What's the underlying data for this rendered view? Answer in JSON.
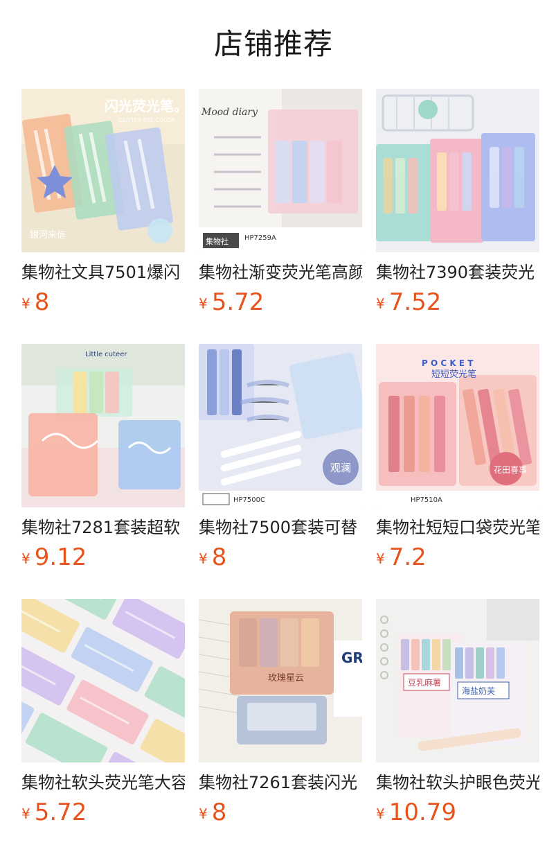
{
  "header": {
    "title": "店铺推荐"
  },
  "currency_symbol": "¥",
  "products": [
    {
      "name": "集物社文具7501爆闪",
      "price": "8",
      "image_text": [
        "闪光荧光笔。",
        "GLITTER EYE COLOR",
        "银河来信"
      ],
      "palette": [
        "#f3e6cf",
        "#f0a37a",
        "#9ed2b4",
        "#b9c7ef"
      ]
    },
    {
      "name": "集物社渐变荧光笔高颜",
      "price": "5.72",
      "image_text": [
        "Mood diary",
        "HP7259A",
        "集物社"
      ],
      "palette": [
        "#ece8e6",
        "#f5c9d2",
        "#c9d6ef",
        "#b7b8e6"
      ]
    },
    {
      "name": "集物社7390套装荧光",
      "price": "7.52",
      "image_text": [],
      "palette": [
        "#eeeff3",
        "#9ed9d4",
        "#f4b6c5",
        "#a9b9f0"
      ]
    },
    {
      "name": "集物社7281套装超软",
      "price": "9.12",
      "image_text": [
        "Little cuteer"
      ],
      "palette": [
        "#eef1ee",
        "#f6b9a8",
        "#bde6d3",
        "#a9c9ee"
      ]
    },
    {
      "name": "集物社7500套装可替",
      "price": "8",
      "image_text": [
        "HP7500C",
        "观澜"
      ],
      "palette": [
        "#e4e6f3",
        "#8fa1d8",
        "#d8ddf3",
        "#6f83c6"
      ]
    },
    {
      "name": "集物社短短口袋荧光笔",
      "price": "7.2",
      "image_text": [
        "P O C K E T",
        "短短荧光笔",
        "花田喜事",
        "HP7510A"
      ],
      "palette": [
        "#fbe7e6",
        "#f2a3a6",
        "#f7c2b3",
        "#e58992"
      ]
    },
    {
      "name": "集物社软头荧光笔大容",
      "price": "5.72",
      "image_text": [],
      "palette": [
        "#f3f1f2",
        "#b5e3cf",
        "#d4c2ef",
        "#f6c4c9"
      ]
    },
    {
      "name": "集物社7261套装闪光",
      "price": "8",
      "image_text": [
        "玫瑰星云",
        "GR"
      ],
      "palette": [
        "#f2efe9",
        "#e9b9a2",
        "#b3c0d8",
        "#e1d5c4"
      ]
    },
    {
      "name": "集物社软头护眼色荧光",
      "price": "10.79",
      "image_text": [
        "豆乳麻薯",
        "海盐奶芙"
      ],
      "palette": [
        "#f1f1ef",
        "#c6bfe5",
        "#a8d6dd",
        "#f3c3b8"
      ]
    }
  ]
}
